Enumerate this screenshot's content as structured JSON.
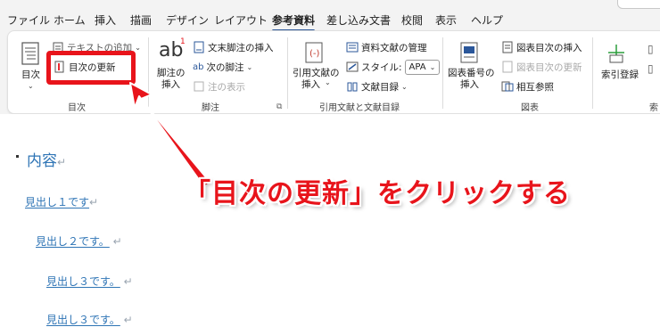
{
  "tabs": [
    "ファイル",
    "ホーム",
    "挿入",
    "描画",
    "デザイン",
    "レイアウト",
    "参考資料",
    "差し込み文書",
    "校閲",
    "表示",
    "ヘルプ"
  ],
  "active_tab": "参考資料",
  "ribbon": {
    "toc_group": {
      "big_button": "目次",
      "add_text": "テキストの追加",
      "update_toc": "目次の更新",
      "label": "目次"
    },
    "footnote_group": {
      "big_button_line1": "脚注の",
      "big_button_line2": "挿入",
      "insert_endnote": "文末脚注の挿入",
      "next_footnote": "次の脚注",
      "show_notes": "注の表示",
      "label": "脚注"
    },
    "citation_group": {
      "big_button_line1": "引用文献の",
      "big_button_line2": "挿入",
      "manage_sources": "資料文献の管理",
      "style_label": "スタイル:",
      "style_value": "APA",
      "bibliography": "文献目録",
      "label": "引用文献と文献目録"
    },
    "caption_group": {
      "big_button_line1": "図表番号の",
      "big_button_line2": "挿入",
      "insert_table_of_figures": "図表目次の挿入",
      "update_table_of_figures": "図表目次の更新",
      "cross_reference": "相互参照",
      "label": "図表"
    },
    "index_group": {
      "mark_entry": "索引登録",
      "label": "索"
    }
  },
  "document": {
    "toc_title": "内容",
    "lines": [
      "見出し１です",
      "見出し２です。",
      "見出し３です。",
      "見出し３です。"
    ]
  },
  "annotation": "「目次の更新」をクリックする",
  "colors": {
    "annotation_red": "#e8141b",
    "link_blue": "#2e74b5",
    "ribbon_bg": "#f3f3f3"
  }
}
